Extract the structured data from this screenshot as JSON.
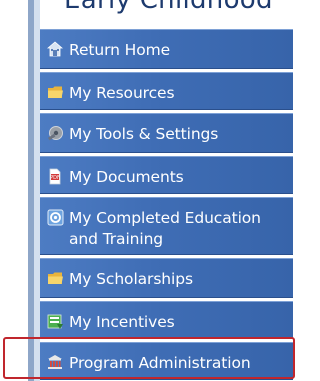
{
  "header": {
    "title": "Early Childhood"
  },
  "menu": {
    "items": [
      {
        "label": "Return Home",
        "icon": "home-icon"
      },
      {
        "label": "My Resources",
        "icon": "folder-icon"
      },
      {
        "label": "My Tools & Settings",
        "icon": "tools-icon"
      },
      {
        "label": "My Documents",
        "icon": "document-icon"
      },
      {
        "label": "My Completed Education and Training",
        "icon": "education-icon"
      },
      {
        "label": "My Scholarships",
        "icon": "folder-icon"
      },
      {
        "label": "My Incentives",
        "icon": "incentives-icon"
      },
      {
        "label": "Program Administration",
        "icon": "building-icon"
      }
    ]
  },
  "colors": {
    "menu_item_bg": "#3f6db5",
    "menu_text": "#ffffff",
    "highlight_border": "#c0262d",
    "header_text": "#1d3a6e"
  }
}
